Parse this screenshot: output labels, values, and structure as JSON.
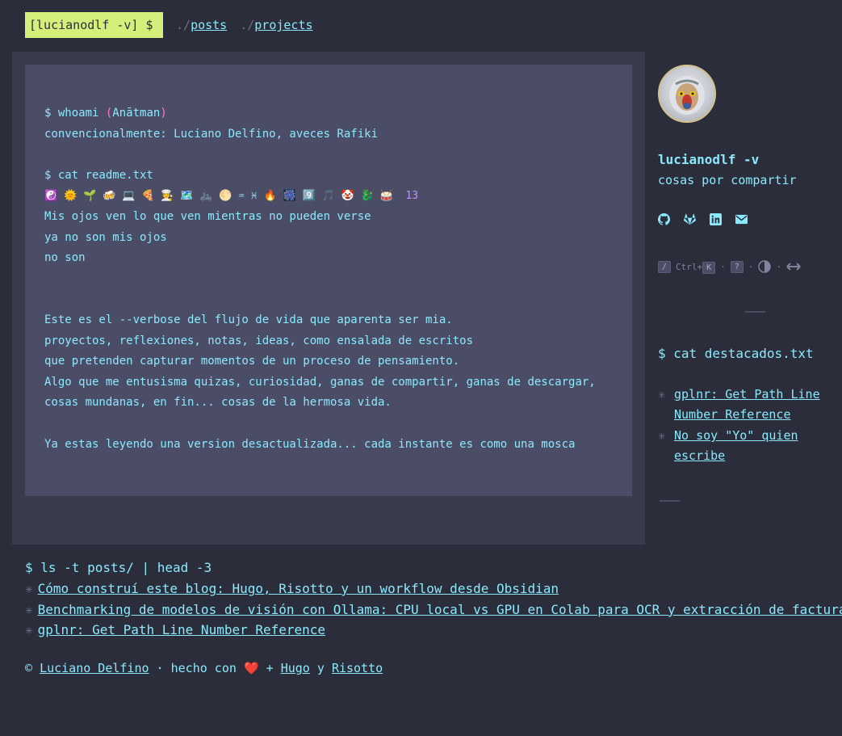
{
  "header": {
    "badge": "[lucianodlf -v] $",
    "nav": [
      {
        "prefix": "./",
        "label": "posts"
      },
      {
        "prefix": "./",
        "label": "projects"
      }
    ]
  },
  "readme": {
    "cmd_whoami": "$ whoami ",
    "whoami_paren_open": "(",
    "whoami_alias": "Anātman",
    "whoami_paren_close": ")",
    "conventional": "convencionalmente: Luciano Delfino, aveces Rafiki",
    "cmd_cat": "$ cat readme.txt",
    "emojis": "☯️ 🌞 🌱 🍻 💻 🍕 🧑‍🍳 🗺️ 🚲 🌕 ♒ ♓ 🔥 🎆 9️⃣ 🎵 🤡 🐉 🥁",
    "emoji_count": "13",
    "poem": [
      "Mis ojos ven lo que ven mientras no pueden verse",
      "ya no son mis ojos",
      "no son"
    ],
    "paragraph": [
      "Este es el --verbose del flujo de vida que aparenta ser mia.",
      "proyectos, reflexiones, notas, ideas, como ensalada de escritos",
      "que pretenden capturar momentos de un proceso de pensamiento.",
      "Algo que me entusisma quizas, curiosidad, ganas de compartir, ganas de descargar,",
      "cosas mundanas, en fin... cosas de la hermosa vida."
    ],
    "closing": "Ya estas leyendo una version desactualizada... cada instante es como una mosca"
  },
  "sidebar": {
    "name": "lucianodlf -v",
    "tagline": "cosas por compartir",
    "socials": [
      "github-icon",
      "gitlab-icon",
      "linkedin-icon",
      "email-icon"
    ],
    "shortcuts": {
      "search_key": "/",
      "ctrl_label": "Ctrl+",
      "k_key": "K",
      "help_key": "?",
      "sep": "·"
    },
    "divider": "———",
    "cmd": "$ cat destacados.txt",
    "featured": [
      "gplnr: Get Path Line Number Reference",
      "No soy \"Yo\" quien escribe"
    ],
    "divider_bottom": "———"
  },
  "recent": {
    "cmd": "$ ls -t posts/ | head -3",
    "posts": [
      "Cómo construí este blog: Hugo, Risotto y un workflow desde Obsidian",
      "Benchmarking de modelos de visión con Ollama: CPU local vs GPU en Colab para OCR y extracción de facturas",
      "gplnr: Get Path Line Number Reference"
    ]
  },
  "footer": {
    "copyright": "© ",
    "author": "Luciano Delfino",
    "made_with": " · hecho con ",
    "heart": "❤️",
    "plus": " + ",
    "hugo": "Hugo",
    "and": " y ",
    "risotto": "Risotto"
  },
  "colors": {
    "background": "#2b2d3a",
    "panel": "#3a3c4e",
    "readme_box": "#4b4c66",
    "accent_text": "#8be9fd",
    "badge": "#d4f07a",
    "paren": "#ff79c6"
  }
}
